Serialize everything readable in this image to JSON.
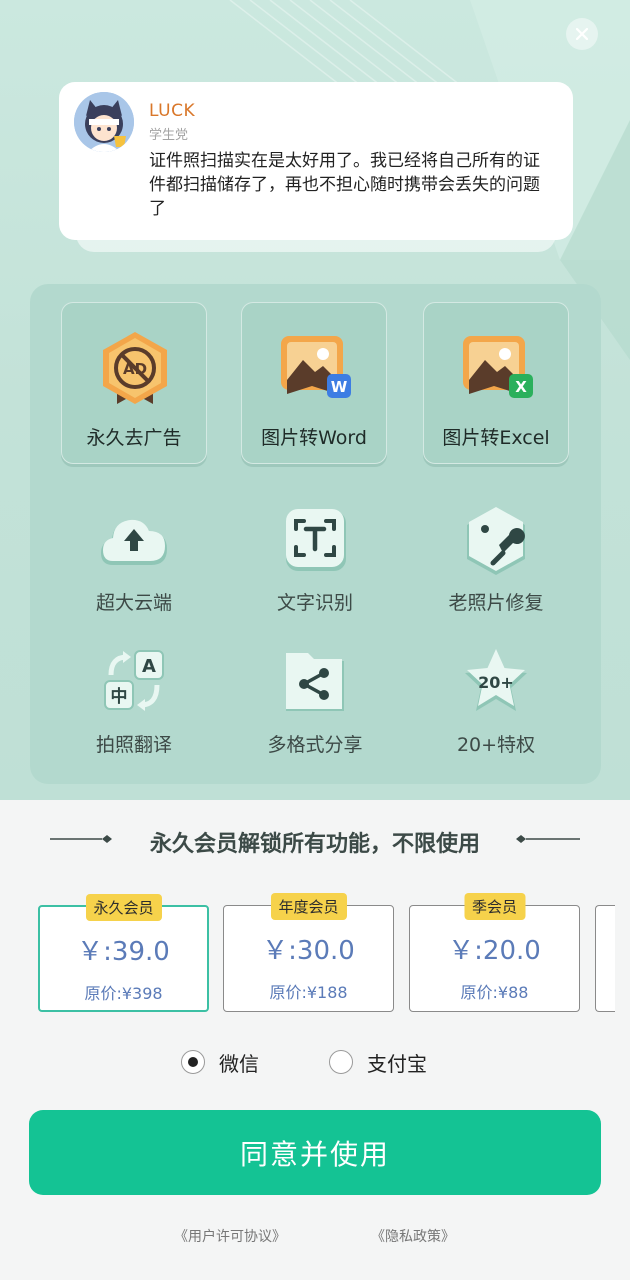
{
  "review": {
    "user_name": "LUCK",
    "user_tag": "学生党",
    "text": "证件照扫描实在是太好用了。我已经将自己所有的证件都扫描储存了，再也不担心随时携带会丢失的问题了"
  },
  "premium_features": [
    {
      "label": "永久去广告",
      "icon": "ad-block-icon"
    },
    {
      "label": "图片转Word",
      "icon": "image-to-word-icon"
    },
    {
      "label": "图片转Excel",
      "icon": "image-to-excel-icon"
    }
  ],
  "features": [
    {
      "label": "超大云端",
      "icon": "cloud-upload-icon"
    },
    {
      "label": "文字识别",
      "icon": "text-recognition-icon"
    },
    {
      "label": "老照片修复",
      "icon": "photo-repair-icon"
    },
    {
      "label": "拍照翻译",
      "icon": "translate-icon"
    },
    {
      "label": "多格式分享",
      "icon": "share-folder-icon"
    },
    {
      "label": "20+特权",
      "icon": "star-badge-icon"
    }
  ],
  "star_badge_text": "20+",
  "section_title": "永久会员解锁所有功能，不限使用",
  "plans": [
    {
      "badge": "永久会员",
      "price": "￥:39.0",
      "original": "原价:¥398",
      "selected": true
    },
    {
      "badge": "年度会员",
      "price": "￥:30.0",
      "original": "原价:¥188",
      "selected": false
    },
    {
      "badge": "季会员",
      "price": "￥:20.0",
      "original": "原价:¥88",
      "selected": false
    }
  ],
  "payment": {
    "options": [
      "微信",
      "支付宝"
    ],
    "selected": "微信"
  },
  "cta_label": "同意并使用",
  "legal": {
    "user_agreement": "《用户许可协议》",
    "privacy_policy": "《隐私政策》"
  },
  "colors": {
    "accent": "#14c394",
    "panel": "#b3d9ce",
    "badge": "#f6d24b",
    "price": "#5b7bb8",
    "orange": "#f0a04a"
  }
}
